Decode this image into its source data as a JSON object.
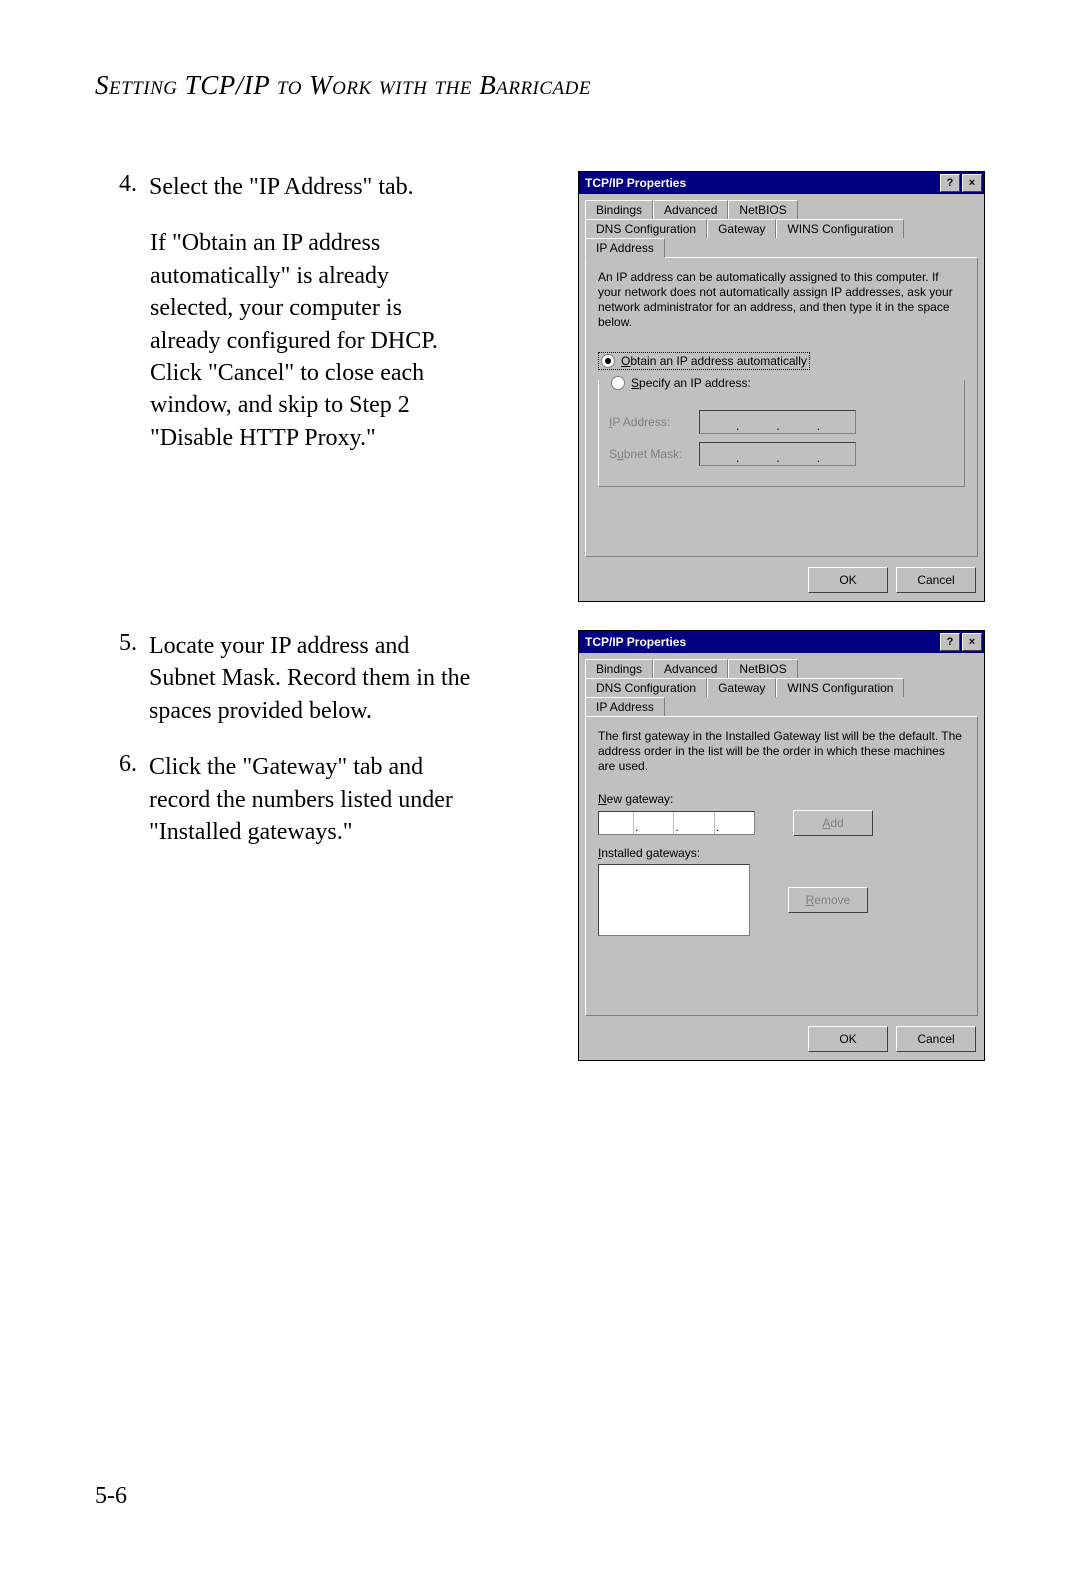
{
  "heading": "Setting TCP/IP to Work with the Barricade",
  "page_number": "5-6",
  "steps": {
    "s4_num": "4.",
    "s4_text": "Select the \"IP Address\" tab.",
    "s4_explain": "If \"Obtain an IP address automatically\" is already selected, your computer is already configured for DHCP. Click \"Cancel\" to close each window, and skip to Step 2 \"Disable HTTP Proxy.\"",
    "s5_num": "5.",
    "s5_text": "Locate your IP address and Subnet Mask. Record them in the spaces provided below.",
    "s6_num": "6.",
    "s6_text": "Click the \"Gateway\" tab and record the numbers listed under \"Installed gateways.\""
  },
  "dialog1": {
    "title": "TCP/IP Properties",
    "help": "?",
    "close": "×",
    "tabs_row1": {
      "t1": "Bindings",
      "t2": "Advanced",
      "t3": "NetBIOS"
    },
    "tabs_row2": {
      "t1": "DNS Configuration",
      "t2": "Gateway",
      "t3": "WINS Configuration",
      "t4": "IP Address"
    },
    "desc": "An IP address can be automatically assigned to this computer. If your network does not automatically assign IP addresses, ask your network administrator for an address, and then type it in the space below.",
    "radio_auto": "Obtain an IP address automatically",
    "radio_auto_ul": "O",
    "radio_spec": "Specify an IP address:",
    "radio_spec_ul": "S",
    "ip_label": "IP Address:",
    "subnet_label": "Subnet Mask:",
    "ok": "OK",
    "cancel": "Cancel"
  },
  "dialog2": {
    "title": "TCP/IP Properties",
    "help": "?",
    "close": "×",
    "tabs_row1": {
      "t1": "Bindings",
      "t2": "Advanced",
      "t3": "NetBIOS"
    },
    "tabs_row2": {
      "t1": "DNS Configuration",
      "t2": "Gateway",
      "t3": "WINS Configuration",
      "t4": "IP Address"
    },
    "desc": "The first gateway in the Installed Gateway list will be the default. The address order in the list will be the order in which these machines are used.",
    "new_gw": "New gateway:",
    "new_gw_ul": "N",
    "add": "Add",
    "add_ul": "A",
    "installed": "Installed gateways:",
    "installed_ul": "I",
    "remove": "Remove",
    "remove_ul": "R",
    "ok": "OK",
    "cancel": "Cancel"
  }
}
